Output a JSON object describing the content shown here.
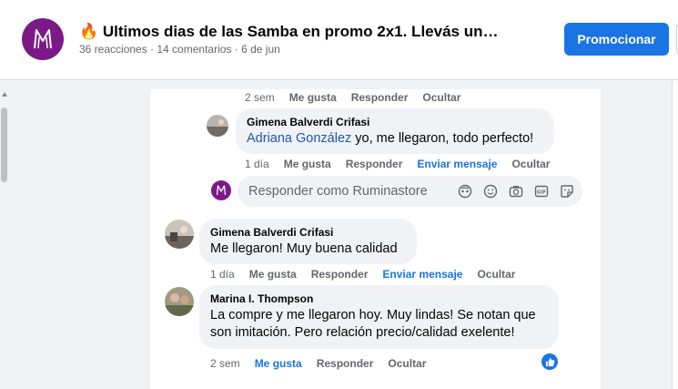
{
  "post": {
    "title": "🔥 Ultimos dias de las Samba en promo 2x1. Llevás un…",
    "meta": "36 reacciones · 14 comentarios · 6 de jun",
    "promote_label": "Promocionar"
  },
  "thread": {
    "top_actions": {
      "time": "2 sem",
      "like": "Me gusta",
      "reply": "Responder",
      "hide": "Ocultar"
    },
    "reply1": {
      "author": "Gimena Balverdi Crifasi",
      "mention": "Adriana González",
      "text": " yo, me llegaron, todo perfecto!",
      "actions": {
        "time": "1 día",
        "like": "Me gusta",
        "reply": "Responder",
        "message": "Enviar mensaje",
        "hide": "Ocultar"
      }
    },
    "reply_box": {
      "placeholder": "Responder como Ruminastore"
    },
    "comment2": {
      "author": "Gimena Balverdi Crifasi",
      "text": "Me llegaron! Muy buena calidad",
      "actions": {
        "time": "1 día",
        "like": "Me gusta",
        "reply": "Responder",
        "message": "Enviar mensaje",
        "hide": "Ocultar"
      }
    },
    "comment3": {
      "author": "Marina I. Thompson",
      "text": "La compre y me llegaron hoy. Muy lindas! Se notan que son imitación. Pero relación precio/calidad exelente!",
      "actions": {
        "time": "2 sem",
        "like": "Me gusta",
        "reply": "Responder",
        "hide": "Ocultar"
      }
    }
  },
  "colors": {
    "accent": "#1b74e4",
    "brand": "#7b1a86",
    "bubble": "#f0f2f5",
    "muted": "#65676b"
  },
  "icons": [
    "logo-icon",
    "avatar-icon",
    "emoji-icon",
    "camera-icon",
    "gif-icon",
    "sticker-icon",
    "avatar-cam-icon",
    "like-icon"
  ]
}
